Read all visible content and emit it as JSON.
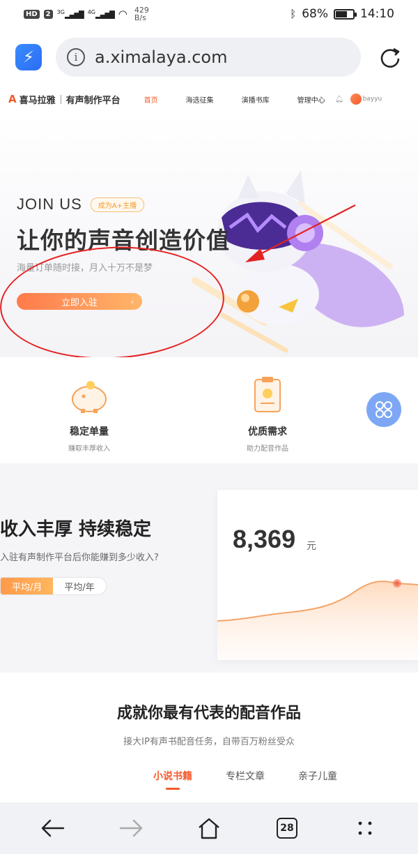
{
  "status_bar": {
    "hd": "HD",
    "sim": "2",
    "net1": "3G",
    "net2": "4G",
    "speed_value": "429",
    "speed_unit": "B/s",
    "battery": "68%",
    "battery_level": 0.68,
    "time": "14:10"
  },
  "browser": {
    "url": "a.ximalaya.com",
    "tab_count": "28"
  },
  "site_nav": {
    "logo_brand": "喜马拉雅",
    "logo_product": "有声制作平台",
    "items": [
      "首页",
      "海选征集",
      "演播书库",
      "管理中心"
    ],
    "active_index": 0,
    "username": "bayyu"
  },
  "hero": {
    "join_title": "JOIN US",
    "join_badge": "成为A+主播",
    "headline": "让你的声音创造价值",
    "subtitle": "海量订单随时接，月入十万不是梦",
    "cta": "立即入驻"
  },
  "features": [
    {
      "title": "稳定单量",
      "desc": "赚取丰厚收入",
      "icon": "piggy-bank-icon"
    },
    {
      "title": "优质需求",
      "desc": "助力配音作品",
      "icon": "clipboard-icon"
    }
  ],
  "income": {
    "title": "收入丰厚 持续稳定",
    "subtitle": "入驻有声制作平台后你能赚到多少收入?",
    "toggle": [
      "平均/月",
      "平均/年"
    ],
    "active_toggle": 0,
    "value": "8,369",
    "unit": "元"
  },
  "works": {
    "title": "成就你最有代表的配音作品",
    "subtitle": "接大IP有声书配音任务，自带百万粉丝受众",
    "tabs": [
      "小说书籍",
      "专栏文章",
      "亲子儿童"
    ],
    "active_tab": 0
  },
  "colors": {
    "accent": "#f35a2b",
    "annotation": "#e52222",
    "fab": "#7da7f5"
  }
}
